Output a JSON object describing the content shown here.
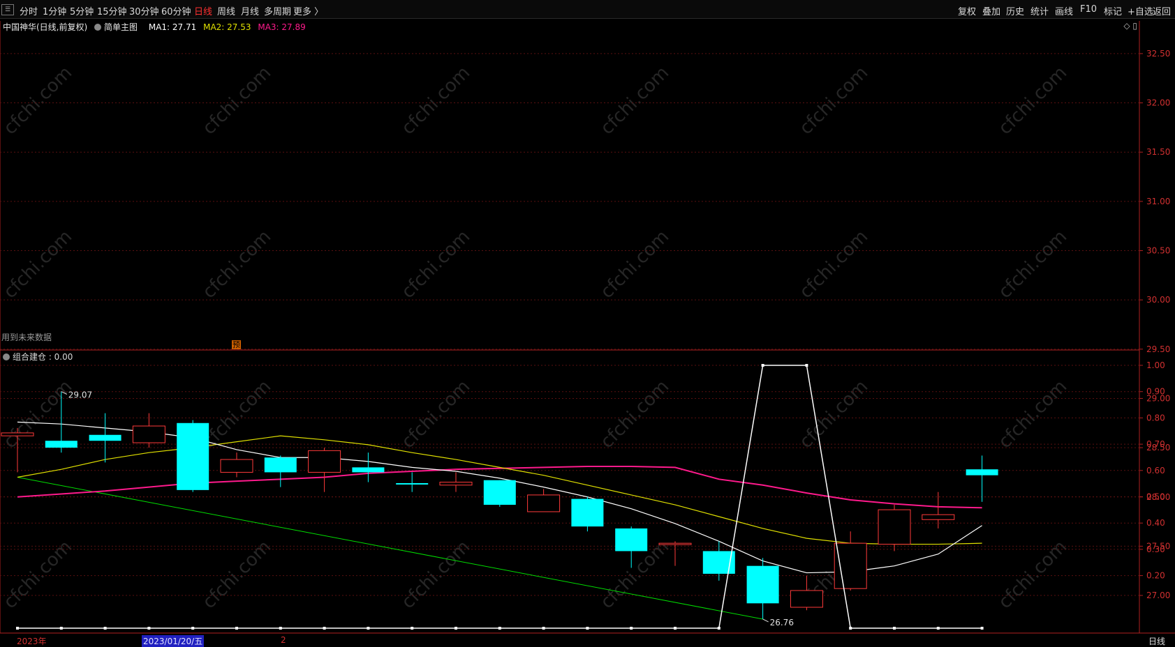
{
  "toolbar": {
    "left_items": [
      "分时",
      "1分钟",
      "5分钟",
      "15分钟",
      "30分钟",
      "60分钟",
      "日线",
      "周线",
      "月线",
      "多周期",
      "更多 〉"
    ],
    "active_item": "日线",
    "right_items": [
      "复权",
      "叠加",
      "历史",
      "统计",
      "画线",
      "F10",
      "标记",
      "+自选",
      "返回"
    ]
  },
  "main_chart": {
    "title": "中国神华(日线,前复权)",
    "template": "简单主图",
    "ma1_label": "MA1: 27.71",
    "ma2_label": "MA2: 27.53",
    "ma3_label": "MA3: 27.89",
    "high_marker": "29.07",
    "low_marker": "26.76",
    "future_data_note": "用到未来数据",
    "pre_mark": "预",
    "right_icons": "◇ ▯"
  },
  "sub_chart": {
    "title": "组合建仓 : 0.00"
  },
  "colors": {
    "up": "#ff3a3a",
    "down": "#00ffff",
    "ma1": "#ffffff",
    "ma2": "#e0e000",
    "ma3": "#ff1a8c",
    "trend": "#00dd00",
    "axis": "#d03030"
  },
  "bottom_bar": {
    "year": "2023年",
    "cursor_date": "2023/01/20/五",
    "small_marker": "2",
    "period": "日线"
  },
  "chart_data": {
    "type": "candlestick",
    "main_y_ticks": [
      "32.50",
      "32.00",
      "31.50",
      "31.00",
      "30.50",
      "30.00",
      "29.50",
      "29.00",
      "28.50",
      "28.00",
      "27.50",
      "27.00"
    ],
    "candles": [
      {
        "o": 28.62,
        "c": 28.65,
        "h": 28.7,
        "l": 28.25
      },
      {
        "o": 28.57,
        "c": 28.5,
        "h": 29.07,
        "l": 28.45
      },
      {
        "o": 28.63,
        "c": 28.57,
        "h": 28.85,
        "l": 28.35
      },
      {
        "o": 28.55,
        "c": 28.72,
        "h": 28.85,
        "l": 28.5
      },
      {
        "o": 28.75,
        "c": 28.07,
        "h": 28.78,
        "l": 28.05
      },
      {
        "o": 28.25,
        "c": 28.38,
        "h": 28.45,
        "l": 28.2
      },
      {
        "o": 28.4,
        "c": 28.25,
        "h": 28.42,
        "l": 28.1
      },
      {
        "o": 28.25,
        "c": 28.47,
        "h": 28.5,
        "l": 28.05
      },
      {
        "o": 28.3,
        "c": 28.25,
        "h": 28.45,
        "l": 28.15
      },
      {
        "o": 28.14,
        "c": 28.13,
        "h": 28.25,
        "l": 28.05
      },
      {
        "o": 28.12,
        "c": 28.15,
        "h": 28.25,
        "l": 28.05
      },
      {
        "o": 28.17,
        "c": 27.92,
        "h": 28.17,
        "l": 27.9
      },
      {
        "o": 27.85,
        "c": 28.02,
        "h": 28.08,
        "l": 27.85
      },
      {
        "o": 27.98,
        "c": 27.7,
        "h": 28.0,
        "l": 27.65
      },
      {
        "o": 27.68,
        "c": 27.45,
        "h": 27.7,
        "l": 27.28
      },
      {
        "o": 27.52,
        "c": 27.53,
        "h": 27.55,
        "l": 27.3
      },
      {
        "o": 27.45,
        "c": 27.22,
        "h": 27.55,
        "l": 27.15
      },
      {
        "o": 27.3,
        "c": 26.92,
        "h": 27.38,
        "l": 26.76
      },
      {
        "o": 26.88,
        "c": 27.05,
        "h": 27.2,
        "l": 26.85
      },
      {
        "o": 27.07,
        "c": 27.53,
        "h": 27.65,
        "l": 27.05
      },
      {
        "o": 27.52,
        "c": 27.87,
        "h": 27.92,
        "l": 27.45
      },
      {
        "o": 27.77,
        "c": 27.82,
        "h": 28.05,
        "l": 27.68
      },
      {
        "o": 28.28,
        "c": 28.22,
        "h": 28.42,
        "l": 27.95
      }
    ],
    "ma1": [
      28.76,
      28.74,
      28.7,
      28.66,
      28.6,
      28.48,
      28.4,
      28.4,
      28.36,
      28.3,
      28.26,
      28.19,
      28.1,
      28.0,
      27.88,
      27.73,
      27.55,
      27.35,
      27.23,
      27.24,
      27.3,
      27.42,
      27.71
    ],
    "ma2": [
      28.2,
      28.28,
      28.38,
      28.45,
      28.5,
      28.56,
      28.62,
      28.58,
      28.53,
      28.45,
      28.38,
      28.3,
      28.22,
      28.12,
      28.02,
      27.92,
      27.8,
      27.68,
      27.58,
      27.53,
      27.52,
      27.52,
      27.53
    ],
    "ma3": [
      28.0,
      28.03,
      28.06,
      28.1,
      28.14,
      28.16,
      28.18,
      28.2,
      28.24,
      28.26,
      28.28,
      28.29,
      28.3,
      28.31,
      28.31,
      28.3,
      28.18,
      28.12,
      28.04,
      27.97,
      27.93,
      27.9,
      27.89
    ],
    "trend_line": {
      "from_index": 0,
      "from_value": 28.2,
      "to_index": 17,
      "to_value": 26.76
    },
    "sub_y_ticks": [
      "1.00",
      "0.90",
      "0.80",
      "0.70",
      "0.60",
      "0.50",
      "0.40",
      "0.30",
      "0.20"
    ],
    "signal": [
      0,
      0,
      0,
      0,
      0,
      0,
      0,
      0,
      0,
      0,
      0,
      0,
      0,
      0,
      0,
      0,
      0,
      1,
      1,
      0,
      0,
      0,
      0
    ]
  }
}
